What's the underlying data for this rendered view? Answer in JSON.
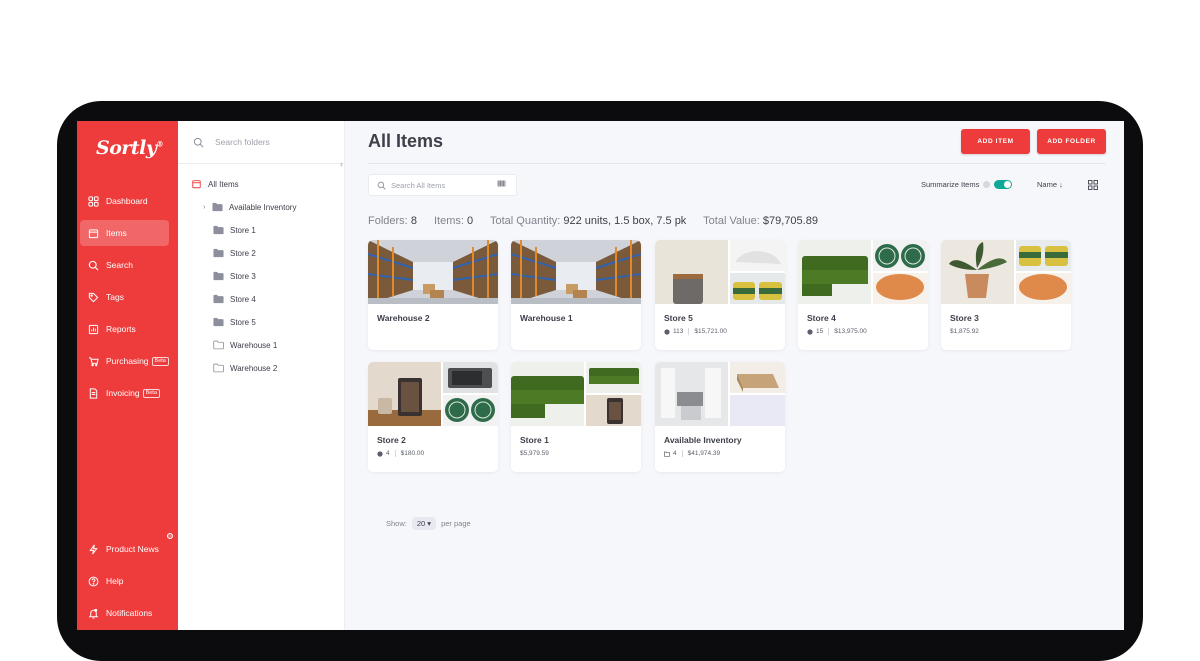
{
  "app": {
    "logo_text": "Sortly",
    "logo_mark": "®"
  },
  "sidebar": {
    "items": [
      {
        "label": "Dashboard",
        "icon": "dashboard-icon"
      },
      {
        "label": "Items",
        "icon": "items-icon",
        "active": true
      },
      {
        "label": "Search",
        "icon": "search-icon"
      },
      {
        "label": "Tags",
        "icon": "tag-icon"
      },
      {
        "label": "Reports",
        "icon": "reports-icon"
      },
      {
        "label": "Purchasing",
        "icon": "purchasing-icon",
        "badge": "Beta"
      },
      {
        "label": "Invoicing",
        "icon": "invoicing-icon",
        "badge": "Beta"
      }
    ],
    "bottom": [
      {
        "label": "Product News",
        "icon": "lightning-icon"
      },
      {
        "label": "Help",
        "icon": "help-icon"
      },
      {
        "label": "Notifications",
        "icon": "bell-icon"
      }
    ]
  },
  "folders": {
    "search_placeholder": "Search folders",
    "root": "All Items",
    "tree": [
      "Available Inventory",
      "Store 1",
      "Store 2",
      "Store 3",
      "Store 4",
      "Store 5",
      "Warehouse 1",
      "Warehouse 2"
    ]
  },
  "main": {
    "title": "All Items",
    "add_item": "ADD ITEM",
    "add_folder": "ADD FOLDER",
    "search_placeholder": "Search All Items",
    "summarize_label": "Summarize Items",
    "sort_label": "Name",
    "stats": {
      "folders_label": "Folders:",
      "folders_value": "8",
      "items_label": "Items:",
      "items_value": "0",
      "qty_label": "Total Quantity:",
      "qty_value": "922 units, 1.5 box, 7.5 pk",
      "value_label": "Total Value:",
      "value_value": "$79,705.89"
    },
    "cards": [
      {
        "name": "Warehouse 2",
        "count": "",
        "value": ""
      },
      {
        "name": "Warehouse 1",
        "count": "",
        "value": ""
      },
      {
        "name": "Store 5",
        "count": "113",
        "value": "$15,721.00"
      },
      {
        "name": "Store 4",
        "count": "15",
        "value": "$13,975.00"
      },
      {
        "name": "Store 3",
        "count": "",
        "value": "$1,875.92"
      },
      {
        "name": "Store 2",
        "count": "4",
        "value": "$180.00"
      },
      {
        "name": "Store 1",
        "count": "",
        "value": "$5,979.59"
      },
      {
        "name": "Available Inventory",
        "count": "4",
        "value": "$41,974.39"
      }
    ],
    "pager": {
      "show_label": "Show:",
      "per_page_value": "20",
      "per_page_label": "per page"
    }
  },
  "colors": {
    "brand": "#ee3b3b",
    "toggle": "#10a896"
  }
}
